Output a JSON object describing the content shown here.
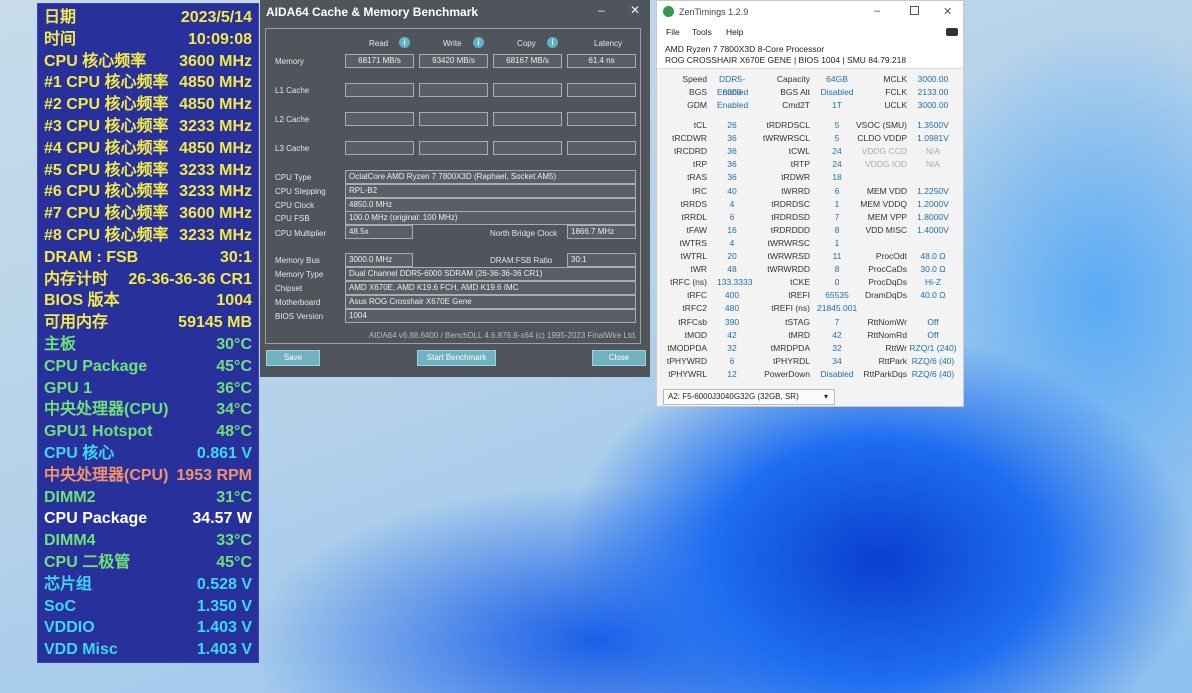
{
  "hwinfo": {
    "rows": [
      {
        "label": "日期",
        "value": "2023/5/14",
        "color": "#f2ea4a"
      },
      {
        "label": "时间",
        "value": "10:09:08",
        "color": "#f2ea4a"
      },
      {
        "label": "CPU 核心频率",
        "value": "3600 MHz",
        "color": "#f2ea4a"
      },
      {
        "label": "#1 CPU 核心频率",
        "value": "4850 MHz",
        "color": "#f2ea4a"
      },
      {
        "label": "#2 CPU 核心频率",
        "value": "4850 MHz",
        "color": "#f2ea4a"
      },
      {
        "label": "#3 CPU 核心频率",
        "value": "3233 MHz",
        "color": "#f2ea4a"
      },
      {
        "label": "#4 CPU 核心频率",
        "value": "4850 MHz",
        "color": "#f2ea4a"
      },
      {
        "label": "#5 CPU 核心频率",
        "value": "3233 MHz",
        "color": "#f2ea4a"
      },
      {
        "label": "#6 CPU 核心频率",
        "value": "3233 MHz",
        "color": "#f2ea4a"
      },
      {
        "label": "#7 CPU 核心频率",
        "value": "3600 MHz",
        "color": "#f2ea4a"
      },
      {
        "label": "#8 CPU 核心频率",
        "value": "3233 MHz",
        "color": "#f2ea4a"
      },
      {
        "label": "DRAM : FSB",
        "value": "30:1",
        "color": "#f2ea4a"
      },
      {
        "label": "内存计时",
        "value": "26-36-36-36 CR1",
        "color": "#f2ea4a"
      },
      {
        "label": "BIOS 版本",
        "value": "1004",
        "color": "#f2ea4a"
      },
      {
        "label": "可用内存",
        "value": "59145 MB",
        "color": "#f2ea4a"
      },
      {
        "label": "主板",
        "value": "30°C",
        "color": "#6fe07a"
      },
      {
        "label": "CPU Package",
        "value": "45°C",
        "color": "#6fe07a"
      },
      {
        "label": "GPU 1",
        "value": "36°C",
        "color": "#6fe07a"
      },
      {
        "label": "中央处理器(CPU)",
        "value": "34°C",
        "color": "#6fe07a"
      },
      {
        "label": "GPU1 Hotspot",
        "value": "48°C",
        "color": "#6fe07a"
      },
      {
        "label": "CPU 核心",
        "value": "0.861 V",
        "color": "#3fd8f0"
      },
      {
        "label": "中央处理器(CPU)",
        "value": "1953 RPM",
        "color": "#f0946a"
      },
      {
        "label": "DIMM2",
        "value": "31°C",
        "color": "#6fe07a"
      },
      {
        "label": "CPU Package",
        "value": "34.57 W",
        "color": "#ffffff"
      },
      {
        "label": "DIMM4",
        "value": "33°C",
        "color": "#6fe07a"
      },
      {
        "label": "CPU 二极管",
        "value": "45°C",
        "color": "#6fe07a"
      },
      {
        "label": "芯片组",
        "value": "0.528 V",
        "color": "#3fd8f0"
      },
      {
        "label": "SoC",
        "value": "1.350 V",
        "color": "#3fd8f0"
      },
      {
        "label": "VDDIO",
        "value": "1.403 V",
        "color": "#3fd8f0"
      },
      {
        "label": "VDD Misc",
        "value": "1.403 V",
        "color": "#3fd8f0"
      }
    ]
  },
  "aida": {
    "title": "AIDA64 Cache & Memory Benchmark",
    "minimize": "–",
    "close": "✕",
    "columns": [
      "Read",
      "Write",
      "Copy",
      "Latency"
    ],
    "bench_rows": [
      {
        "label": "Memory",
        "values": [
          "68171 MB/s",
          "93420 MB/s",
          "68167 MB/s",
          "61.4 ns"
        ]
      },
      {
        "label": "L1 Cache",
        "values": [
          "",
          "",
          "",
          ""
        ]
      },
      {
        "label": "L2 Cache",
        "values": [
          "",
          "",
          "",
          ""
        ]
      },
      {
        "label": "L3 Cache",
        "values": [
          "",
          "",
          "",
          ""
        ]
      }
    ],
    "cpu_type_label": "CPU Type",
    "cpu_type": "OctalCore AMD Ryzen 7 7800X3D  (Raphael, Socket AM5)",
    "cpu_stepping_label": "CPU Stepping",
    "cpu_stepping": "RPL-B2",
    "cpu_clock_label": "CPU Clock",
    "cpu_clock": "4850.0 MHz",
    "cpu_fsb_label": "CPU FSB",
    "cpu_fsb": "100.0 MHz  (original: 100 MHz)",
    "cpu_mult_label": "CPU Multiplier",
    "cpu_mult": "48.5x",
    "nb_clock_label": "North Bridge Clock",
    "nb_clock": "1866.7 MHz",
    "mem_bus_label": "Memory Bus",
    "mem_bus": "3000.0 MHz",
    "dram_ratio_label": "DRAM:FSB Ratio",
    "dram_ratio": "30:1",
    "mem_type_label": "Memory Type",
    "mem_type": "Dual Channel DDR5-6000 SDRAM  (26-36-36-36 CR1)",
    "chipset_label": "Chipset",
    "chipset": "AMD X670E, AMD K19.6 FCH, AMD K19.6 IMC",
    "mobo_label": "Motherboard",
    "mobo": "Asus ROG Crosshair X670E Gene",
    "bios_label": "BIOS Version",
    "bios": "1004",
    "footer": "AIDA64 v6.88.6400 / BenchDLL 4.6.876.8-x64  (c) 1995-2023 FinalWire Ltd.",
    "save": "Save",
    "start": "Start Benchmark",
    "close_btn": "Close"
  },
  "zen": {
    "title": "ZenTimings 1.2.9",
    "menu": [
      "File",
      "Tools",
      "Help"
    ],
    "cpu": "AMD Ryzen 7 7800X3D 8-Core Processor",
    "board": "ROG CROSSHAIR X670E GENE | BIOS 1004 | SMU 84.79.218",
    "top": [
      [
        "Speed",
        "DDR5-6000",
        "Capacity",
        "64GB",
        "MCLK",
        "3000.00"
      ],
      [
        "BGS",
        "Enabled",
        "BGS Alt",
        "Disabled",
        "FCLK",
        "2133.00"
      ],
      [
        "GDM",
        "Enabled",
        "Cmd2T",
        "1T",
        "UCLK",
        "3000.00"
      ]
    ],
    "timings": [
      [
        "tCL",
        "26",
        "tRDRDSCL",
        "5",
        "VSOC (SMU)",
        "1.3500V"
      ],
      [
        "tRCDWR",
        "36",
        "tWRWRSCL",
        "5",
        "CLDO VDDP",
        "1.0981V"
      ],
      [
        "tRCDRD",
        "36",
        "tCWL",
        "24",
        "VDDG CCD",
        "N/A"
      ],
      [
        "tRP",
        "36",
        "tRTP",
        "24",
        "VDDG IOD",
        "N/A"
      ],
      [
        "tRAS",
        "36",
        "tRDWR",
        "18",
        "",
        ""
      ],
      [
        "tRC",
        "40",
        "tWRRD",
        "6",
        "MEM VDD",
        "1.2250V"
      ],
      [
        "tRRDS",
        "4",
        "tRDRDSC",
        "1",
        "MEM VDDQ",
        "1.2000V"
      ],
      [
        "tRRDL",
        "6",
        "tRDRDSD",
        "7",
        "MEM VPP",
        "1.8000V"
      ],
      [
        "tFAW",
        "16",
        "tRDRDDD",
        "8",
        "VDD MISC",
        "1.4000V"
      ],
      [
        "tWTRS",
        "4",
        "tWRWRSC",
        "1",
        "",
        ""
      ],
      [
        "tWTRL",
        "20",
        "tWRWRSD",
        "11",
        "ProcOdt",
        "48.0 Ω"
      ],
      [
        "tWR",
        "48",
        "tWRWRDD",
        "8",
        "ProcCaDs",
        "30.0 Ω"
      ],
      [
        "tRFC (ns)",
        "133.3333",
        "tCKE",
        "0",
        "ProcDqDs",
        "Hi-Z"
      ],
      [
        "tRFC",
        "400",
        "tREFI",
        "65535",
        "DramDqDs",
        "40.0 Ω"
      ],
      [
        "tRFC2",
        "480",
        "tREFI (ns)",
        "21845.001",
        "",
        ""
      ],
      [
        "tRFCsb",
        "390",
        "tSTAG",
        "7",
        "RttNomWr",
        "Off"
      ],
      [
        "tMOD",
        "42",
        "tMRD",
        "42",
        "RttNomRd",
        "Off"
      ],
      [
        "tMODPDA",
        "32",
        "tMRDPDA",
        "32",
        "RttWr",
        "RZQ/1 (240)"
      ],
      [
        "tPHYWRD",
        "6",
        "tPHYRDL",
        "34",
        "RttPark",
        "RZQ/6 (40)"
      ],
      [
        "tPHYWRL",
        "12",
        "PowerDown",
        "Disabled",
        "RttParkDqs",
        "RZQ/6 (40)"
      ]
    ],
    "dimm_select": "A2: F5-6000J3040G32G (32GB, SR)"
  }
}
